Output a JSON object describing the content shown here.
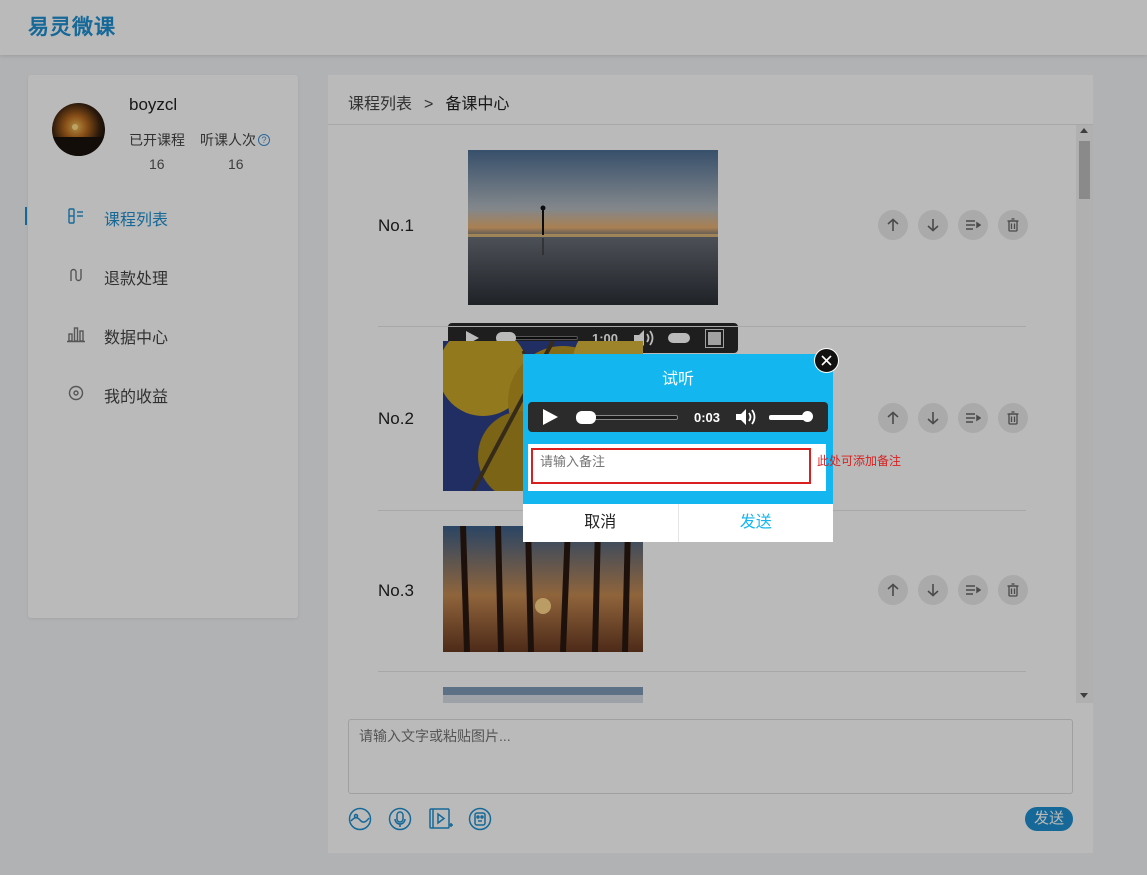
{
  "header": {
    "logo_text": "易灵微课"
  },
  "profile": {
    "username": "boyzcl",
    "stats": [
      {
        "label": "已开课程",
        "value": "16"
      },
      {
        "label": "听课人次",
        "value": "16"
      }
    ],
    "help_glyph": "?"
  },
  "nav": [
    {
      "label": "课程列表",
      "icon": "course-list-icon",
      "active": true
    },
    {
      "label": "退款处理",
      "icon": "refund-icon",
      "active": false
    },
    {
      "label": "数据中心",
      "icon": "chart-icon",
      "active": false
    },
    {
      "label": "我的收益",
      "icon": "earnings-icon",
      "active": false
    }
  ],
  "breadcrumb": {
    "parent": "课程列表",
    "separator": ">",
    "current": "备课中心"
  },
  "lessons": [
    {
      "no": "No.1",
      "media": "video",
      "video_time": "1:00"
    },
    {
      "no": "No.2",
      "media": "image"
    },
    {
      "no": "No.3",
      "media": "image"
    }
  ],
  "composer": {
    "placeholder": "请输入文字或粘贴图片...",
    "send_label": "发送"
  },
  "modal": {
    "title": "试听",
    "audio_time": "0:03",
    "note_placeholder": "请输入备注",
    "note_hint": "此处可添加备注",
    "cancel_label": "取消",
    "send_label": "发送"
  },
  "colors": {
    "brand": "#1d8fcf",
    "modal_bg": "#13b6ef",
    "hint_red": "#d91f1f"
  }
}
